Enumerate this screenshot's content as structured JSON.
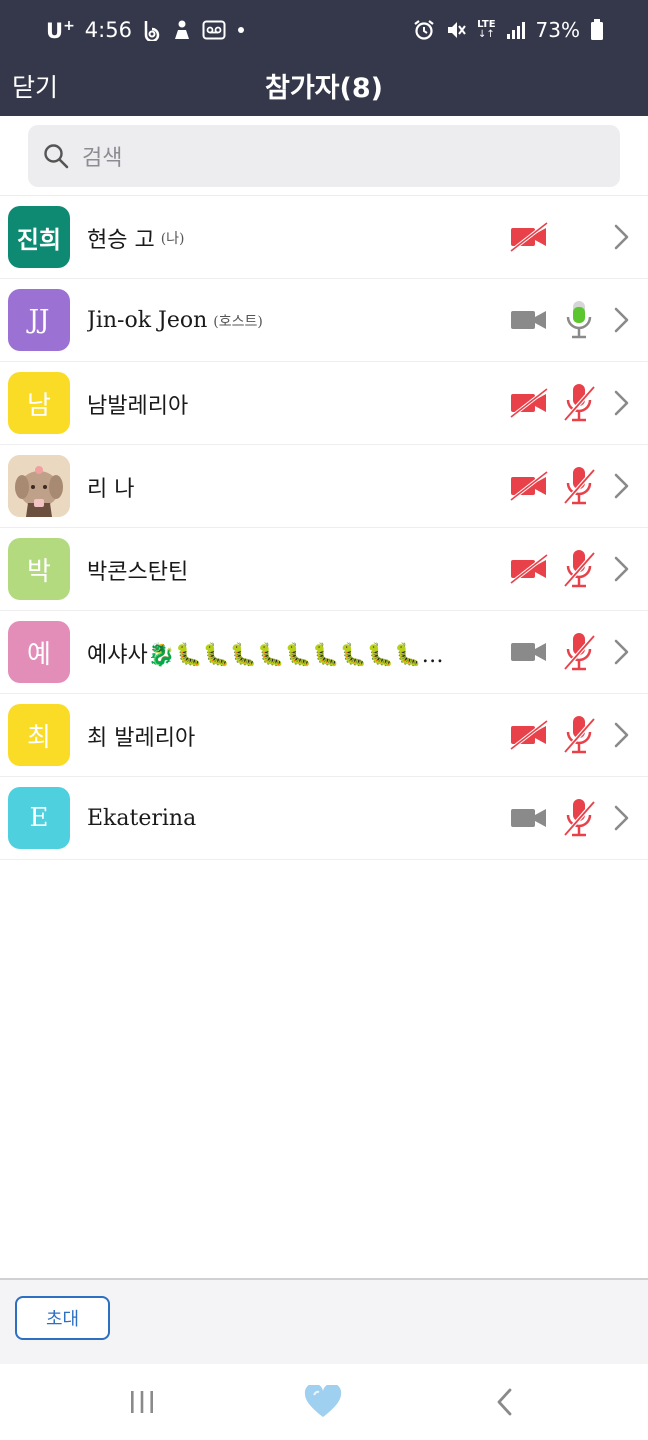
{
  "status": {
    "carrier": "U",
    "carrier_sup": "+",
    "time": "4:56",
    "network": "LTE",
    "battery": "73%"
  },
  "header": {
    "close_label": "닫기",
    "title": "참가자(8)"
  },
  "search": {
    "placeholder": "검색"
  },
  "participants": [
    {
      "avatar_text": "진희",
      "avatar_color": "#0e8a73",
      "name": "현승 고",
      "tag": "(나)",
      "camera": "off",
      "mic": "none"
    },
    {
      "avatar_text": "JJ",
      "avatar_color": "#9b72d4",
      "name": "Jin-ok Jeon",
      "tag": "(호스트)",
      "camera": "on",
      "mic": "active"
    },
    {
      "avatar_text": "남",
      "avatar_color": "#fadc26",
      "name": "남발레리아",
      "tag": "",
      "camera": "off",
      "mic": "muted"
    },
    {
      "avatar_text": "",
      "avatar_color": "#e8d2b4",
      "name": "리 나",
      "tag": "",
      "camera": "off",
      "mic": "muted"
    },
    {
      "avatar_text": "박",
      "avatar_color": "#b4da80",
      "name": "박콘스탄틴",
      "tag": "",
      "camera": "off",
      "mic": "muted"
    },
    {
      "avatar_text": "예",
      "avatar_color": "#e38db9",
      "name": "예샤사🐉🐛🐛🐛🐛🐛🐛🐛🐛🐛…",
      "tag": "",
      "camera": "on",
      "mic": "muted"
    },
    {
      "avatar_text": "최",
      "avatar_color": "#fadc26",
      "name": "최 발레리아",
      "tag": "",
      "camera": "off",
      "mic": "muted"
    },
    {
      "avatar_text": "E",
      "avatar_color": "#4fd0de",
      "name": "Ekaterina",
      "tag": "",
      "camera": "on",
      "mic": "muted"
    }
  ],
  "footer": {
    "invite_label": "초대"
  },
  "colors": {
    "header_bg": "#35384b",
    "muted_red": "#e8414a",
    "active_green": "#5cc631",
    "camera_gray": "#8a8a8a",
    "invite_blue": "#2d6fc0"
  }
}
